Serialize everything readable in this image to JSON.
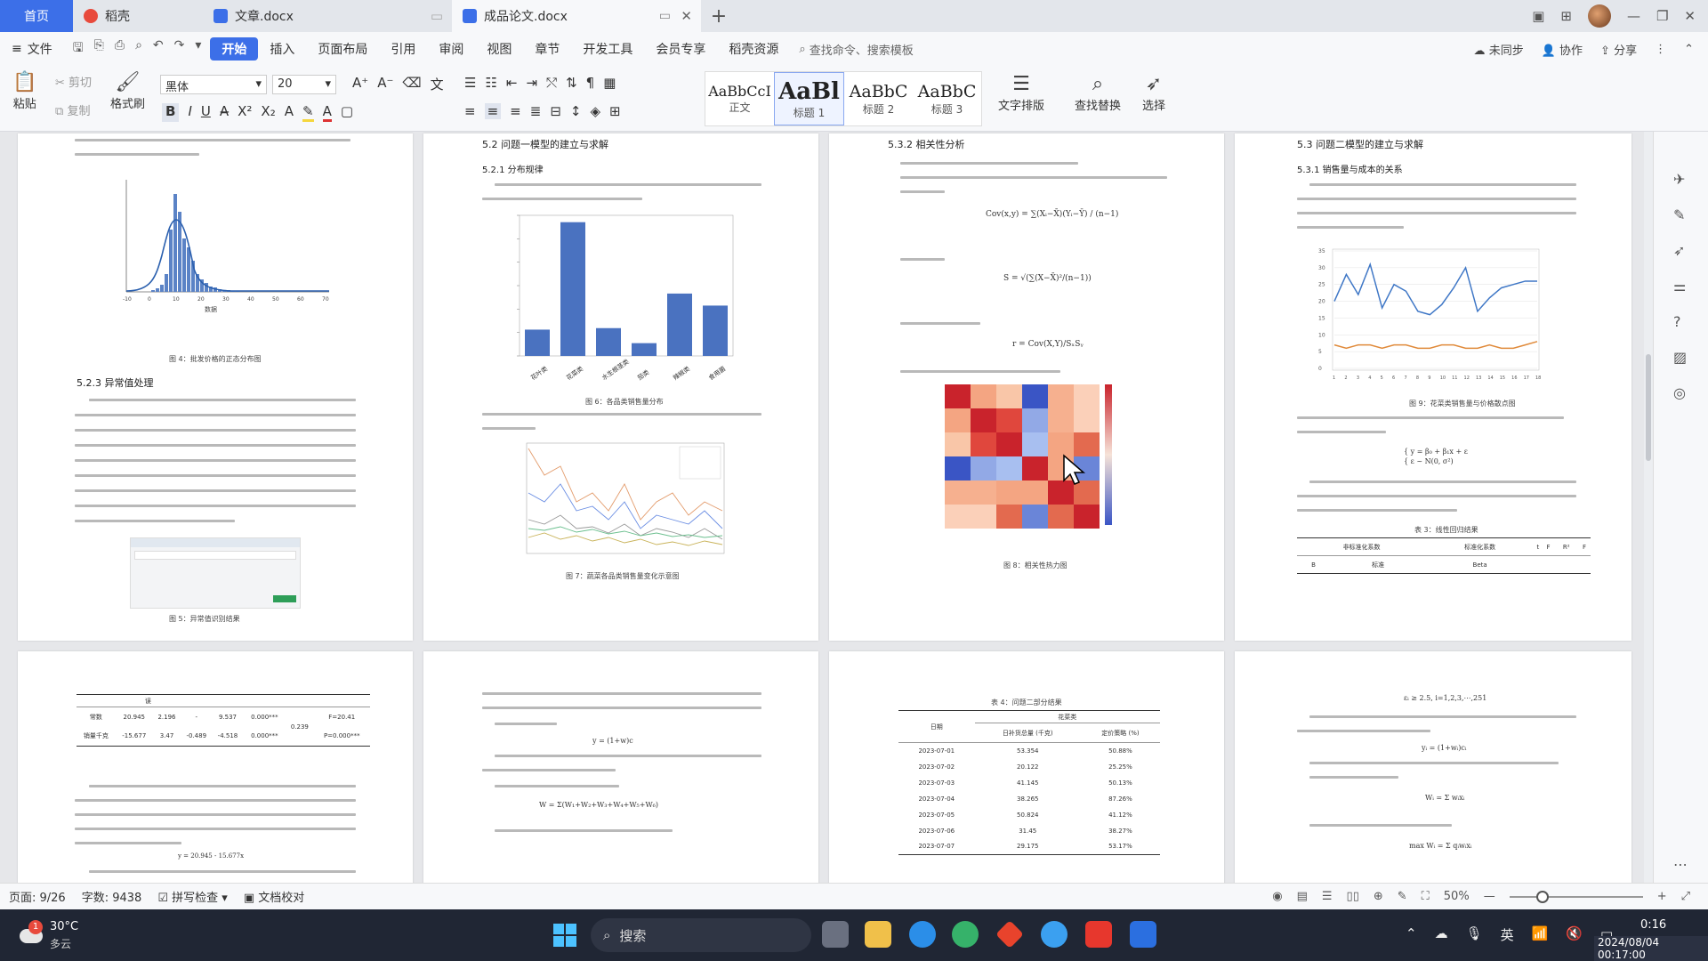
{
  "tabs": {
    "home": "首页",
    "items": [
      {
        "label": "稻壳",
        "color": "#e84a3c"
      },
      {
        "label": "文章.docx",
        "color": "#3c6fe8"
      },
      {
        "label": "成品论文.docx",
        "color": "#3c6fe8"
      }
    ]
  },
  "menu": {
    "file": "文件",
    "items": [
      "开始",
      "插入",
      "页面布局",
      "引用",
      "审阅",
      "视图",
      "章节",
      "开发工具",
      "会员专享",
      "稻壳资源"
    ],
    "search_placeholder": "查找命令、搜索模板",
    "right": [
      "未同步",
      "协作",
      "分享"
    ]
  },
  "ribbon": {
    "paste": "粘贴",
    "cut": "剪切",
    "copy": "复制",
    "format_painter": "格式刷",
    "font": "黑体",
    "size": "20",
    "styles": [
      {
        "preview": "AaBbCcI",
        "name": "正文"
      },
      {
        "preview": "AaBl",
        "name": "标题 1"
      },
      {
        "preview": "AaBbC",
        "name": "标题 2"
      },
      {
        "preview": "AaBbC",
        "name": "标题 3"
      }
    ],
    "text_layout": "文字排版",
    "find_replace": "查找替换",
    "select": "选择"
  },
  "pages": {
    "p1": {
      "heading": "5.2.3 异常值处理",
      "fig4": "图 4：批发价格的正态分布图",
      "fig5": "图 5：异常值识别结果",
      "hist_x": [
        "-10",
        "0",
        "10",
        "20",
        "30",
        "40",
        "50",
        "60",
        "70"
      ],
      "hist_xlabel": "数据"
    },
    "p2": {
      "h1": "5.2 问题一模型的建立与求解",
      "h2": "5.2.1 分布规律",
      "fig6": "图 6：各品类销售量分布",
      "fig7": "图 7：蔬菜各品类销售量变化示意图",
      "bar_categories": [
        "花叶类",
        "花菜类",
        "水生根茎类",
        "茄类",
        "辣椒类",
        "食用菌"
      ]
    },
    "p3": {
      "heading": "5.3.2 相关性分析",
      "fig8": "图 8：相关性热力图",
      "f1": "Cov(x,y)",
      "f2": "S",
      "f3": "r"
    },
    "p4": {
      "h1": "5.3 问题二模型的建立与求解",
      "h2": "5.3.1 销售量与成本的关系",
      "fig9": "图 9：花菜类销售量与价格散点图",
      "table3": "表 3：线性回归结果",
      "t3_headers": [
        "非标准化系数",
        "标准化系数",
        "t",
        "F",
        "R²",
        "F"
      ],
      "t3_sub": [
        "B",
        "标准",
        "Beta"
      ]
    },
    "p5": {
      "rows": [
        [
          "常数",
          "20.945",
          "2.196",
          "-",
          "9.537",
          "0.000***"
        ],
        [
          "销量千克",
          "-15.677",
          "3.47",
          "-0.489",
          "-4.518",
          "0.000***"
        ]
      ],
      "side": [
        "0.239",
        "F=20.41",
        "P=0.000***"
      ],
      "formula": "y = 20.945 - 15.677x"
    },
    "p7": {
      "caption": "表 4：问题二部分结果",
      "headers": [
        "日期",
        "花菜类",
        "日补货总量 (千克)",
        "定价策略 (%)"
      ],
      "rows": [
        [
          "2023-07-01",
          "53.354",
          "50.88%"
        ],
        [
          "2023-07-02",
          "20.122",
          "25.25%"
        ],
        [
          "2023-07-03",
          "41.145",
          "50.13%"
        ],
        [
          "2023-07-04",
          "38.265",
          "87.26%"
        ],
        [
          "2023-07-05",
          "50.824",
          "41.12%"
        ],
        [
          "2023-07-06",
          "31.45",
          "38.27%"
        ],
        [
          "2023-07-07",
          "29.175",
          "53.17%"
        ]
      ]
    },
    "p8": {
      "f1": "εᵢ ≥ 2.5, i=1,2,3,⋯,251",
      "f2": "yᵢ = (1+wᵢ)cᵢ",
      "f3": "Wᵢ = Σ wᵢxᵢ",
      "f4": "max Wᵢ = Σ qᵢwᵢxᵢ"
    }
  },
  "status": {
    "page": "页面: 9/26",
    "words": "字数: 9438",
    "spell": "拼写检查",
    "proof": "文档校对",
    "zoom": "50%"
  },
  "taskbar": {
    "temp": "30°C",
    "weather": "多云",
    "search": "搜索",
    "ime": "英",
    "time": "0:16",
    "date": "2024/08/04",
    "overlay_date": "2024/08/04 00:17:00",
    "weather_badge": "1"
  },
  "colors": {
    "accent": "#3c6fe8",
    "bar": "#4a72c0"
  },
  "chart_data": [
    {
      "type": "bar",
      "categories": [
        "花叶类",
        "花菜类",
        "水生根茎类",
        "茄类",
        "辣椒类",
        "食用菌"
      ],
      "values": [
        35000,
        178000,
        37000,
        17000,
        83000,
        67000
      ],
      "ylim": [
        0,
        180000
      ]
    },
    {
      "type": "line",
      "x": [
        "1",
        "2",
        "3",
        "4",
        "5",
        "6",
        "7",
        "8",
        "9",
        "10",
        "11",
        "12",
        "13",
        "14",
        "15",
        "16",
        "17",
        "18"
      ],
      "series": [
        {
          "values": [
            20,
            28,
            22,
            31,
            18,
            25,
            23,
            17,
            16,
            19,
            24,
            30,
            17,
            21,
            24,
            25,
            26,
            26
          ]
        },
        {
          "values": [
            7,
            6,
            7,
            7,
            6,
            7,
            7,
            6,
            6,
            7,
            7,
            6,
            6,
            7,
            6,
            6,
            7,
            8
          ]
        }
      ],
      "ylim": [
        0,
        35
      ],
      "yticks": [
        "0",
        "5",
        "10",
        "15",
        "20",
        "25",
        "30",
        "35"
      ]
    }
  ]
}
